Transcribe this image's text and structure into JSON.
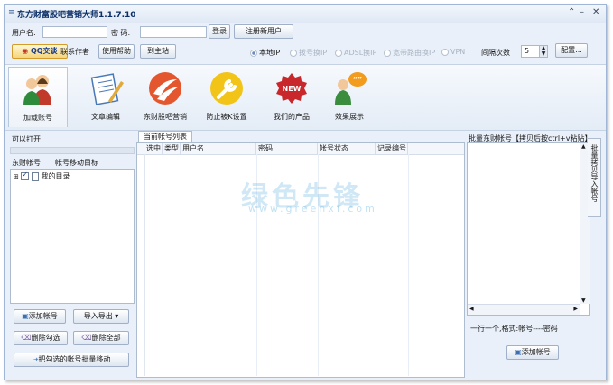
{
  "app": {
    "title": "东方财富股吧营销大师1.1.7.10"
  },
  "login": {
    "username_label": "用户名:",
    "password_label": "密  码:",
    "login_button": "登录",
    "register_button": "注册新用户"
  },
  "toolbar": {
    "qq_label": "QQ交谈",
    "contact_label": "联系作者",
    "help_label": "使用帮助",
    "site_label": "到主站"
  },
  "options": {
    "radios": [
      "本地IP",
      "拨号换IP",
      "ADSL换IP",
      "宽带路由换IP",
      "VPN"
    ],
    "selected": "本地IP",
    "interval_label": "间隔次数",
    "interval_value": "5",
    "settings_button": "配置..."
  },
  "ribbon": {
    "items": [
      "加载账号",
      "文章编辑",
      "东财股吧营销",
      "防止被K设置",
      "我们的产品",
      "效果展示"
    ],
    "active": "加载账号"
  },
  "left_panel": {
    "header": "可以打开",
    "tab_account": "东财帐号",
    "tab_move": "帐号移动目标",
    "tree_root": "我的目录"
  },
  "left_buttons": {
    "add_account": "添加帐号",
    "import_export": "导入导出",
    "delete_checked": "删除勾选",
    "delete_all": "删除全部",
    "move_checked": "把勾选的帐号批量移动"
  },
  "center_panel": {
    "tab": "当前帐号列表",
    "columns": [
      "选中",
      "类型",
      "用户名",
      "密码",
      "帐号状态",
      "记录编号"
    ]
  },
  "right_panel": {
    "header": "批量东财帐号【拷贝后按ctrl+v粘贴】",
    "side_tab": "批量拷贝导入帐号",
    "hint": "一行一个,格式:帐号----密码",
    "add_button": "添加帐号"
  },
  "watermark": {
    "text": "绿色先锋",
    "url": "www.greenxf.com"
  },
  "colors": {
    "title": "#0b2e67",
    "panel_border": "#aebcd0",
    "background": "#e9f0f9"
  }
}
